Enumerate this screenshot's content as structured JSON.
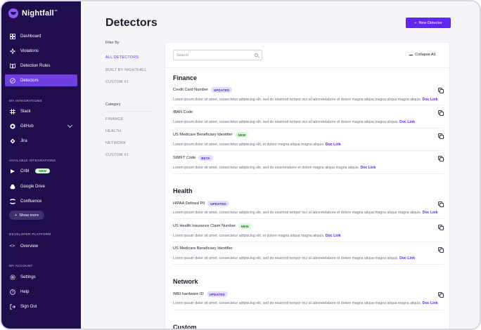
{
  "sidebar": {
    "logo": "Nightfall",
    "logo_tm": "™",
    "items": [
      {
        "label": "Dashboard",
        "icon": "dashboard-icon"
      },
      {
        "label": "Violations",
        "icon": "violations-icon"
      },
      {
        "label": "Detection Rules",
        "icon": "book-icon"
      },
      {
        "label": "Detectors",
        "icon": "compass-icon",
        "active": true
      }
    ],
    "my_integrations_label": "MY INTEGRATIONS",
    "integrations": [
      {
        "label": "Slack",
        "icon": "slack-icon"
      },
      {
        "label": "GitHub",
        "icon": "github-icon"
      },
      {
        "label": "Jira",
        "icon": "jira-icon"
      }
    ],
    "available_integrations_label": "AVAILABLE INTEGRATIONS",
    "available": [
      {
        "label": "Cribl",
        "icon": "cribl-icon",
        "badge": "NEW"
      },
      {
        "label": "Google Drive",
        "icon": "google-drive-icon"
      },
      {
        "label": "Confluence",
        "icon": "confluence-icon"
      }
    ],
    "show_more": "Show more",
    "developer_platform_label": "DEVELOPER PLATFORM",
    "overview": "Overview",
    "my_account_label": "MY ACCOUNT",
    "account": [
      {
        "label": "Settings",
        "icon": "gear-icon"
      },
      {
        "label": "Help",
        "icon": "help-icon"
      },
      {
        "label": "Sign Out",
        "icon": "sign-out-icon"
      }
    ]
  },
  "header": {
    "title": "Detectors",
    "new_button": "New Detector"
  },
  "filters": {
    "heading": "Filter By",
    "items": [
      "ALL DETECTORS",
      "BUILT BY NIGHTFALL",
      "CUSTOM #1"
    ],
    "category_heading": "Category",
    "categories": [
      "FINANCE",
      "HEALTH",
      "NETWORK",
      "CUSTOM #1"
    ]
  },
  "panel": {
    "search_placeholder": "Search",
    "collapse_all": "Collapse All",
    "groups": [
      {
        "title": "Finance",
        "detectors": [
          {
            "name": "Credit Card Number",
            "badge": "UPDATED",
            "desc": "Lorem ipsum dolor sit amet, consectetur adipiscing elit, sed do eiusmod tempor inci ut laboretelabore et dolore magna aliqua magna aliqua magna aliquis.",
            "doc": "Doc Link"
          },
          {
            "name": "IBAN Code",
            "badge": "",
            "desc": "Lorem ipsum dolor sit amet, consectetur adipiscing elit, sed do eiusmod tempor inci ut laboretelabore et dolore magna aliqua magna aliquis.",
            "doc": "Doc Link"
          },
          {
            "name": "US Medicare Beneficiary Identifier",
            "badge": "NEW",
            "desc": "Lorem ipsum dolor sit amet, consectetur adipiscing elit, et dolore magna aliqua magna aliquis.",
            "doc": "Doc Link"
          },
          {
            "name": "SWIFT Code",
            "badge": "BETA",
            "desc": "Lorem ipsum dolor sit amet, consectetur adipiscing elit, sed do eiusmelabore et dolore magna aliqua magna aliquis.",
            "doc": "Doc Link"
          }
        ]
      },
      {
        "title": "Health",
        "detectors": [
          {
            "name": "HIPAA Defined PII",
            "badge": "UPDATED",
            "desc": "Lorem ipsum dolor sit amet, consectetur adipiscing elit, sed do eiusmod tempor inci ut laboretelabore et dolore magna aliqua magna aliqua magna aliquis.",
            "doc": "Doc Link"
          },
          {
            "name": "US Health Insurance Claim Number",
            "badge": "NEW",
            "desc": "Lorem ipsum dolor sit amet, consectetur adipiscing elit, et dolore magna aliqua magna aliquis.",
            "doc": "Doc Link"
          },
          {
            "name": "US Medicare Beneficiary Identifier",
            "badge": "",
            "desc": "Lorem ipsum dolor sit amet, consectetur adipiscing elit, sed do eiusmod tempor inci ut laboretelabore et dolore magna aliqua magna aliquis.",
            "doc": "Doc Link"
          }
        ]
      },
      {
        "title": "Network",
        "detectors": [
          {
            "name": "IMEI hardware ID",
            "badge": "UPDATED",
            "desc": "Lorem ipsum dolor sit amet, consectetur adipiscing elit, sed do eiusmod tempor inci ut laboretelabore et dolore magna aliqua magna aliqua magna aliquis.",
            "doc": "Doc Link"
          }
        ]
      },
      {
        "title": "Custom",
        "detectors": []
      }
    ]
  },
  "colors": {
    "sidebar_bg": "#1f0d4d",
    "accent": "#6226ef",
    "active_nav": "#6d3fe0"
  }
}
